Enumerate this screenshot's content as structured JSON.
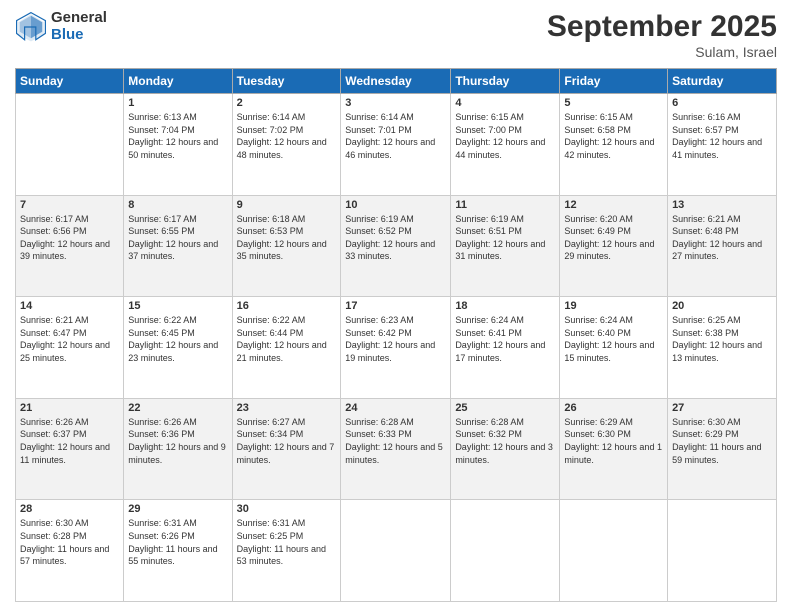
{
  "header": {
    "logo_general": "General",
    "logo_blue": "Blue",
    "month_title": "September 2025",
    "location": "Sulam, Israel"
  },
  "days_of_week": [
    "Sunday",
    "Monday",
    "Tuesday",
    "Wednesday",
    "Thursday",
    "Friday",
    "Saturday"
  ],
  "weeks": [
    [
      {
        "day": "",
        "sunrise": "",
        "sunset": "",
        "daylight": ""
      },
      {
        "day": "1",
        "sunrise": "Sunrise: 6:13 AM",
        "sunset": "Sunset: 7:04 PM",
        "daylight": "Daylight: 12 hours and 50 minutes."
      },
      {
        "day": "2",
        "sunrise": "Sunrise: 6:14 AM",
        "sunset": "Sunset: 7:02 PM",
        "daylight": "Daylight: 12 hours and 48 minutes."
      },
      {
        "day": "3",
        "sunrise": "Sunrise: 6:14 AM",
        "sunset": "Sunset: 7:01 PM",
        "daylight": "Daylight: 12 hours and 46 minutes."
      },
      {
        "day": "4",
        "sunrise": "Sunrise: 6:15 AM",
        "sunset": "Sunset: 7:00 PM",
        "daylight": "Daylight: 12 hours and 44 minutes."
      },
      {
        "day": "5",
        "sunrise": "Sunrise: 6:15 AM",
        "sunset": "Sunset: 6:58 PM",
        "daylight": "Daylight: 12 hours and 42 minutes."
      },
      {
        "day": "6",
        "sunrise": "Sunrise: 6:16 AM",
        "sunset": "Sunset: 6:57 PM",
        "daylight": "Daylight: 12 hours and 41 minutes."
      }
    ],
    [
      {
        "day": "7",
        "sunrise": "Sunrise: 6:17 AM",
        "sunset": "Sunset: 6:56 PM",
        "daylight": "Daylight: 12 hours and 39 minutes."
      },
      {
        "day": "8",
        "sunrise": "Sunrise: 6:17 AM",
        "sunset": "Sunset: 6:55 PM",
        "daylight": "Daylight: 12 hours and 37 minutes."
      },
      {
        "day": "9",
        "sunrise": "Sunrise: 6:18 AM",
        "sunset": "Sunset: 6:53 PM",
        "daylight": "Daylight: 12 hours and 35 minutes."
      },
      {
        "day": "10",
        "sunrise": "Sunrise: 6:19 AM",
        "sunset": "Sunset: 6:52 PM",
        "daylight": "Daylight: 12 hours and 33 minutes."
      },
      {
        "day": "11",
        "sunrise": "Sunrise: 6:19 AM",
        "sunset": "Sunset: 6:51 PM",
        "daylight": "Daylight: 12 hours and 31 minutes."
      },
      {
        "day": "12",
        "sunrise": "Sunrise: 6:20 AM",
        "sunset": "Sunset: 6:49 PM",
        "daylight": "Daylight: 12 hours and 29 minutes."
      },
      {
        "day": "13",
        "sunrise": "Sunrise: 6:21 AM",
        "sunset": "Sunset: 6:48 PM",
        "daylight": "Daylight: 12 hours and 27 minutes."
      }
    ],
    [
      {
        "day": "14",
        "sunrise": "Sunrise: 6:21 AM",
        "sunset": "Sunset: 6:47 PM",
        "daylight": "Daylight: 12 hours and 25 minutes."
      },
      {
        "day": "15",
        "sunrise": "Sunrise: 6:22 AM",
        "sunset": "Sunset: 6:45 PM",
        "daylight": "Daylight: 12 hours and 23 minutes."
      },
      {
        "day": "16",
        "sunrise": "Sunrise: 6:22 AM",
        "sunset": "Sunset: 6:44 PM",
        "daylight": "Daylight: 12 hours and 21 minutes."
      },
      {
        "day": "17",
        "sunrise": "Sunrise: 6:23 AM",
        "sunset": "Sunset: 6:42 PM",
        "daylight": "Daylight: 12 hours and 19 minutes."
      },
      {
        "day": "18",
        "sunrise": "Sunrise: 6:24 AM",
        "sunset": "Sunset: 6:41 PM",
        "daylight": "Daylight: 12 hours and 17 minutes."
      },
      {
        "day": "19",
        "sunrise": "Sunrise: 6:24 AM",
        "sunset": "Sunset: 6:40 PM",
        "daylight": "Daylight: 12 hours and 15 minutes."
      },
      {
        "day": "20",
        "sunrise": "Sunrise: 6:25 AM",
        "sunset": "Sunset: 6:38 PM",
        "daylight": "Daylight: 12 hours and 13 minutes."
      }
    ],
    [
      {
        "day": "21",
        "sunrise": "Sunrise: 6:26 AM",
        "sunset": "Sunset: 6:37 PM",
        "daylight": "Daylight: 12 hours and 11 minutes."
      },
      {
        "day": "22",
        "sunrise": "Sunrise: 6:26 AM",
        "sunset": "Sunset: 6:36 PM",
        "daylight": "Daylight: 12 hours and 9 minutes."
      },
      {
        "day": "23",
        "sunrise": "Sunrise: 6:27 AM",
        "sunset": "Sunset: 6:34 PM",
        "daylight": "Daylight: 12 hours and 7 minutes."
      },
      {
        "day": "24",
        "sunrise": "Sunrise: 6:28 AM",
        "sunset": "Sunset: 6:33 PM",
        "daylight": "Daylight: 12 hours and 5 minutes."
      },
      {
        "day": "25",
        "sunrise": "Sunrise: 6:28 AM",
        "sunset": "Sunset: 6:32 PM",
        "daylight": "Daylight: 12 hours and 3 minutes."
      },
      {
        "day": "26",
        "sunrise": "Sunrise: 6:29 AM",
        "sunset": "Sunset: 6:30 PM",
        "daylight": "Daylight: 12 hours and 1 minute."
      },
      {
        "day": "27",
        "sunrise": "Sunrise: 6:30 AM",
        "sunset": "Sunset: 6:29 PM",
        "daylight": "Daylight: 11 hours and 59 minutes."
      }
    ],
    [
      {
        "day": "28",
        "sunrise": "Sunrise: 6:30 AM",
        "sunset": "Sunset: 6:28 PM",
        "daylight": "Daylight: 11 hours and 57 minutes."
      },
      {
        "day": "29",
        "sunrise": "Sunrise: 6:31 AM",
        "sunset": "Sunset: 6:26 PM",
        "daylight": "Daylight: 11 hours and 55 minutes."
      },
      {
        "day": "30",
        "sunrise": "Sunrise: 6:31 AM",
        "sunset": "Sunset: 6:25 PM",
        "daylight": "Daylight: 11 hours and 53 minutes."
      },
      {
        "day": "",
        "sunrise": "",
        "sunset": "",
        "daylight": ""
      },
      {
        "day": "",
        "sunrise": "",
        "sunset": "",
        "daylight": ""
      },
      {
        "day": "",
        "sunrise": "",
        "sunset": "",
        "daylight": ""
      },
      {
        "day": "",
        "sunrise": "",
        "sunset": "",
        "daylight": ""
      }
    ]
  ]
}
